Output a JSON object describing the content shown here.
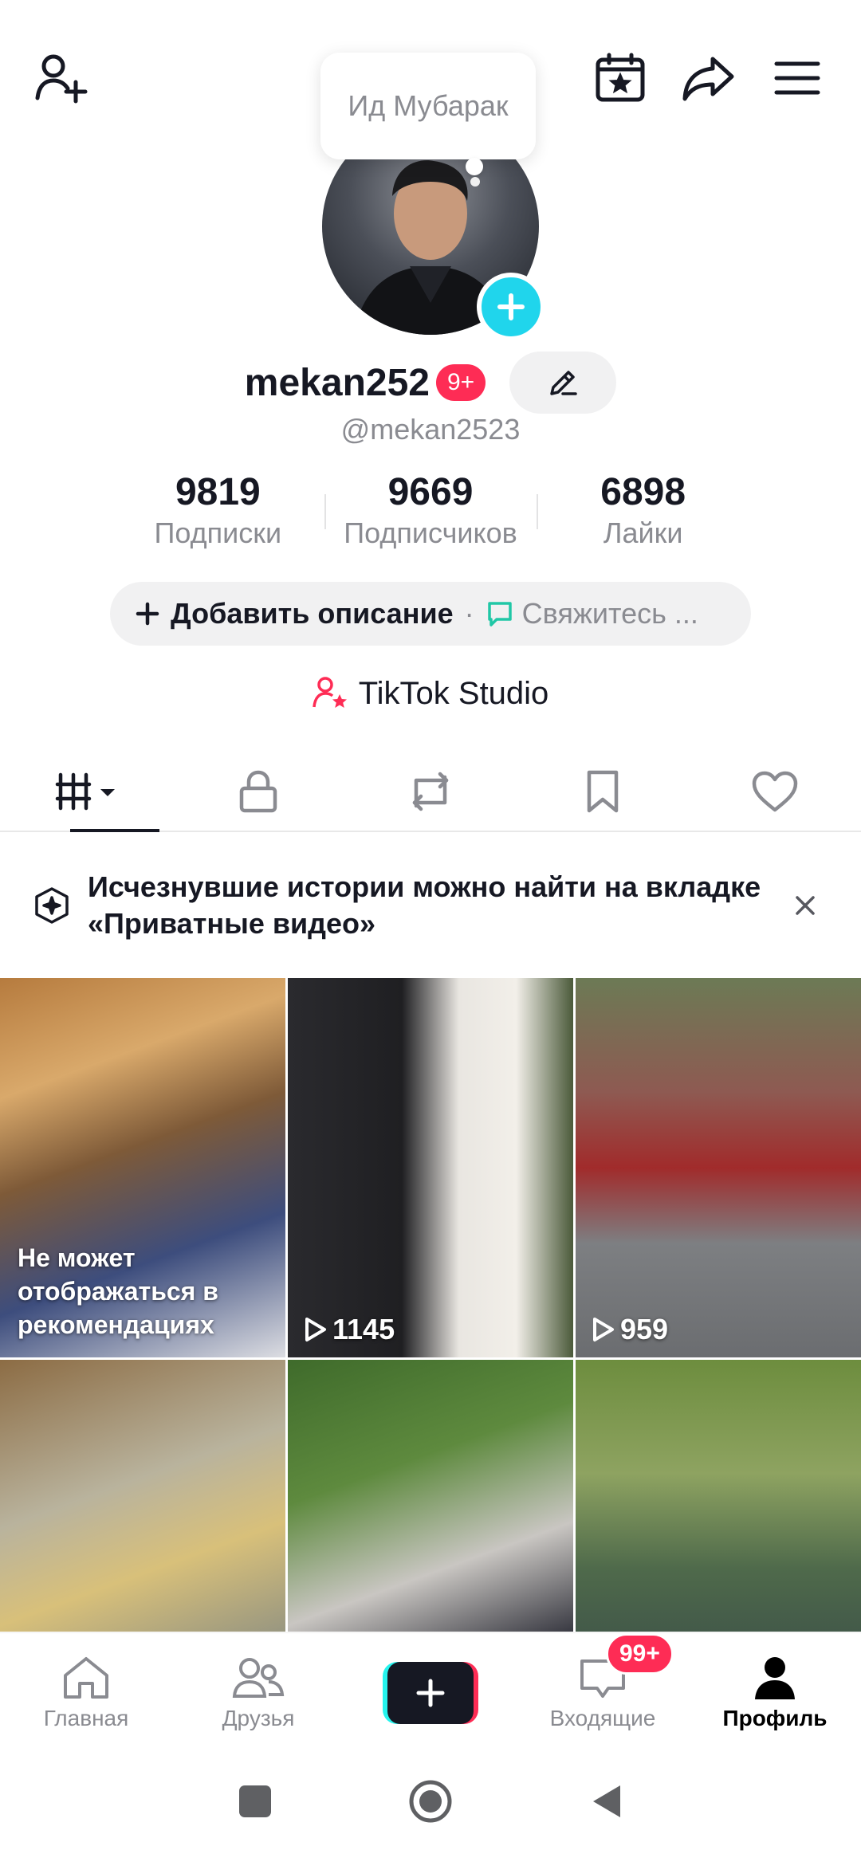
{
  "header": {
    "add_friend_icon": "person-plus-icon",
    "calendar_icon": "calendar-star-icon",
    "share_icon": "share-arrow-icon",
    "menu_icon": "hamburger-menu-icon"
  },
  "note": {
    "text": "Ид Мубарак"
  },
  "profile": {
    "username": "mekan252",
    "badge": "9+",
    "handle": "@mekan2523"
  },
  "stats": [
    {
      "value": "9819",
      "label": "Подписки"
    },
    {
      "value": "9669",
      "label": "Подписчиков"
    },
    {
      "value": "6898",
      "label": "Лайки"
    }
  ],
  "description": {
    "add_label": "Добавить описание",
    "separator": "·",
    "contact_label": "Свяжитесь ..."
  },
  "studio": {
    "label": "TikTok Studio"
  },
  "tabs": [
    {
      "icon": "videos-grid-icon",
      "active": true
    },
    {
      "icon": "lock-icon",
      "active": false
    },
    {
      "icon": "repost-icon",
      "active": false
    },
    {
      "icon": "bookmark-icon",
      "active": false
    },
    {
      "icon": "heart-icon",
      "active": false
    }
  ],
  "banner": {
    "text": "Исчезнувшие истории можно найти на вкладке «Приватные видео»"
  },
  "grid": [
    {
      "overlay_text": "Не может отображаться в рекомендациях",
      "views": ""
    },
    {
      "overlay_text": "",
      "views": "1145"
    },
    {
      "overlay_text": "",
      "views": "959"
    },
    {
      "overlay_text": "",
      "views": ""
    },
    {
      "overlay_text": "",
      "views": ""
    },
    {
      "overlay_text": "",
      "views": ""
    }
  ],
  "bottom_nav": [
    {
      "label": "Главная",
      "icon": "home-icon",
      "active": false
    },
    {
      "label": "Друзья",
      "icon": "friends-icon",
      "active": false
    },
    {
      "label": "",
      "icon": "create-plus-icon",
      "active": false
    },
    {
      "label": "Входящие",
      "icon": "inbox-icon",
      "active": false,
      "badge": "99+"
    },
    {
      "label": "Профиль",
      "icon": "profile-icon",
      "active": true
    }
  ],
  "colors": {
    "accent_red": "#fe2c55",
    "accent_cyan": "#20d5ec",
    "text_primary": "#161823",
    "text_secondary": "#8a8b91"
  }
}
